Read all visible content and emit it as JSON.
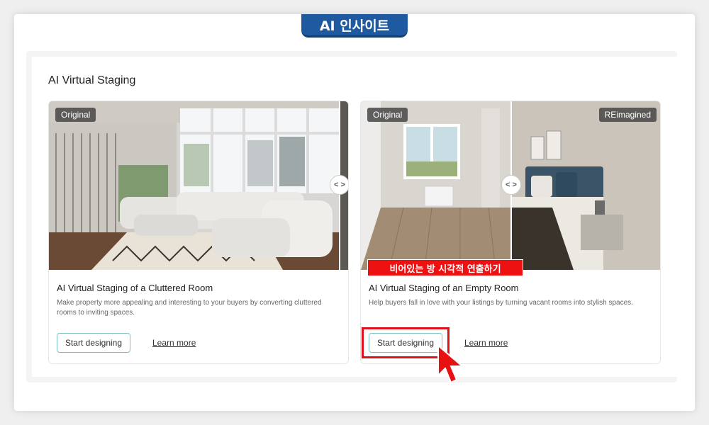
{
  "header": {
    "title": "AI 인사이트"
  },
  "section": {
    "title": "AI Virtual Staging"
  },
  "cards": [
    {
      "badges": [
        "Original"
      ],
      "title": "AI Virtual Staging of a Cluttered Room",
      "description": "Make property more appealing and interesting to your buyers by converting cluttered rooms to inviting spaces.",
      "button_label": "Start designing",
      "link_label": "Learn more"
    },
    {
      "badges": [
        "Original",
        "REimagined"
      ],
      "title": "AI Virtual Staging of an Empty Room",
      "description": "Help buyers fall in love with your listings by turning vacant rooms into stylish spaces.",
      "button_label": "Start designing",
      "link_label": "Learn more"
    }
  ],
  "annotation": {
    "label": "비어있는 방 시각적 연출하기"
  },
  "slider": {
    "glyph": "< >"
  },
  "colors": {
    "header_blue": "#1f5aa0",
    "highlight_red": "#e0101a",
    "button_border": "#7cc1c0"
  }
}
